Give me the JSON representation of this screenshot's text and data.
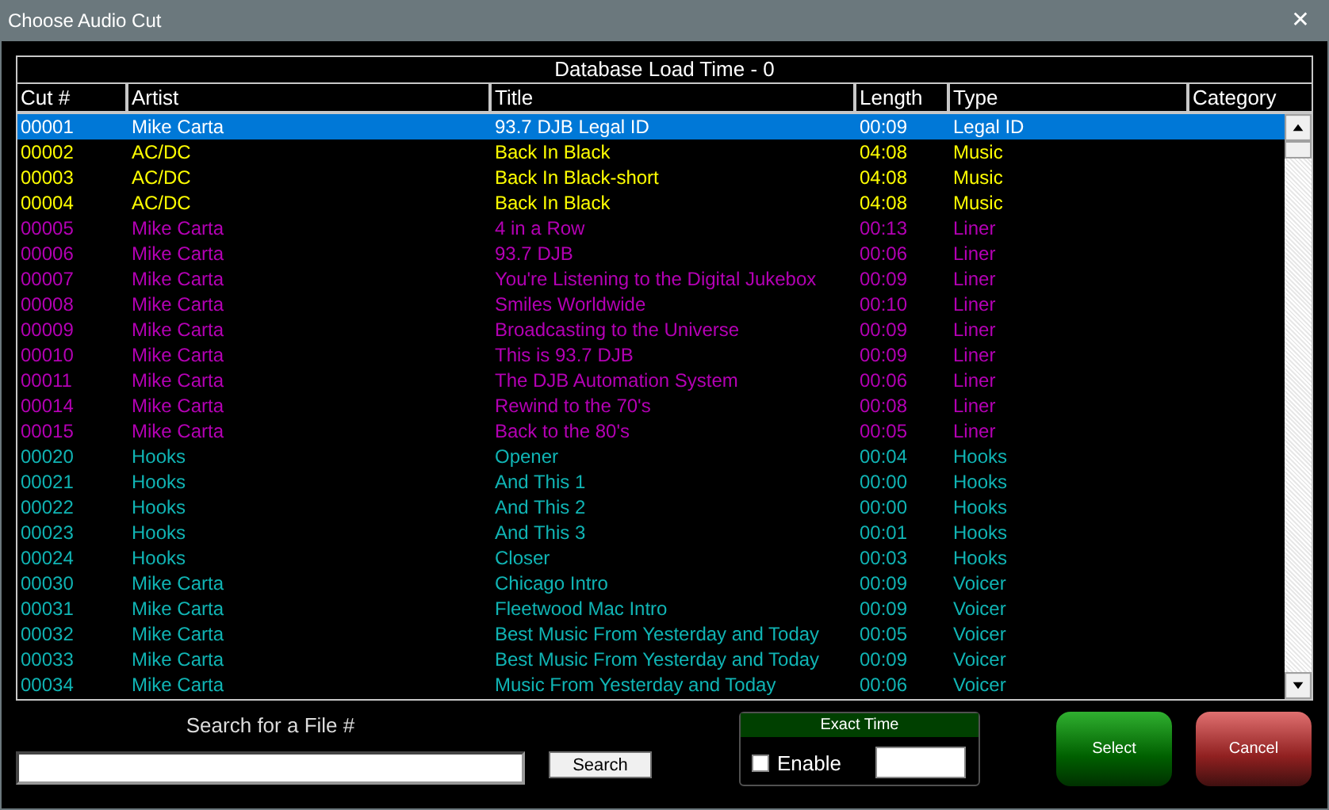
{
  "window": {
    "title": "Choose Audio Cut",
    "close": "✕"
  },
  "table": {
    "caption": "Database Load Time - 0",
    "columns": [
      "Cut #",
      "Artist",
      "Title",
      "Length",
      "Type",
      "Category"
    ],
    "rows": [
      {
        "cut": "00001",
        "artist": "Mike Carta",
        "title": "93.7 DJB Legal ID",
        "length": "00:09",
        "type": "Legal ID",
        "selected": true
      },
      {
        "cut": "00002",
        "artist": "AC/DC",
        "title": "Back In Black",
        "length": "04:08",
        "type": "Music",
        "color": "#ffff00",
        "selected": false
      },
      {
        "cut": "00003",
        "artist": "AC/DC",
        "title": "Back In Black-short",
        "length": "04:08",
        "type": "Music",
        "color": "#ffff00",
        "selected": false
      },
      {
        "cut": "00004",
        "artist": "AC/DC",
        "title": "Back In Black",
        "length": "04:08",
        "type": "Music",
        "color": "#ffff00",
        "selected": false
      },
      {
        "cut": "00005",
        "artist": "Mike Carta",
        "title": "4 in a Row",
        "length": "00:13",
        "type": "Liner",
        "color": "#b400b4",
        "selected": false
      },
      {
        "cut": "00006",
        "artist": "Mike Carta",
        "title": "93.7 DJB",
        "length": "00:06",
        "type": "Liner",
        "color": "#b400b4",
        "selected": false
      },
      {
        "cut": "00007",
        "artist": "Mike Carta",
        "title": "You're Listening to the Digital Jukebox",
        "length": "00:09",
        "type": "Liner",
        "color": "#b400b4",
        "selected": false
      },
      {
        "cut": "00008",
        "artist": "Mike Carta",
        "title": "Smiles Worldwide",
        "length": "00:10",
        "type": "Liner",
        "color": "#b400b4",
        "selected": false
      },
      {
        "cut": "00009",
        "artist": "Mike Carta",
        "title": "Broadcasting to the Universe",
        "length": "00:09",
        "type": "Liner",
        "color": "#b400b4",
        "selected": false
      },
      {
        "cut": "00010",
        "artist": "Mike Carta",
        "title": "This is 93.7 DJB",
        "length": "00:09",
        "type": "Liner",
        "color": "#b400b4",
        "selected": false
      },
      {
        "cut": "00011",
        "artist": "Mike Carta",
        "title": "The DJB Automation System",
        "length": "00:06",
        "type": "Liner",
        "color": "#b400b4",
        "selected": false
      },
      {
        "cut": "00014",
        "artist": "Mike Carta",
        "title": "Rewind to the 70's",
        "length": "00:08",
        "type": "Liner",
        "color": "#b400b4",
        "selected": false
      },
      {
        "cut": "00015",
        "artist": "Mike Carta",
        "title": "Back to the 80's",
        "length": "00:05",
        "type": "Liner",
        "color": "#b400b4",
        "selected": false
      },
      {
        "cut": "00020",
        "artist": "Hooks",
        "title": "Opener",
        "length": "00:04",
        "type": "Hooks",
        "color": "#10b4b4",
        "selected": false
      },
      {
        "cut": "00021",
        "artist": "Hooks",
        "title": "And This 1",
        "length": "00:00",
        "type": "Hooks",
        "color": "#10b4b4",
        "selected": false
      },
      {
        "cut": "00022",
        "artist": "Hooks",
        "title": "And This 2",
        "length": "00:00",
        "type": "Hooks",
        "color": "#10b4b4",
        "selected": false
      },
      {
        "cut": "00023",
        "artist": "Hooks",
        "title": "And This 3",
        "length": "00:01",
        "type": "Hooks",
        "color": "#10b4b4",
        "selected": false
      },
      {
        "cut": "00024",
        "artist": "Hooks",
        "title": "Closer",
        "length": "00:03",
        "type": "Hooks",
        "color": "#10b4b4",
        "selected": false
      },
      {
        "cut": "00030",
        "artist": "Mike Carta",
        "title": "Chicago Intro",
        "length": "00:09",
        "type": "Voicer",
        "color": "#10b4b4",
        "selected": false
      },
      {
        "cut": "00031",
        "artist": "Mike Carta",
        "title": "Fleetwood Mac Intro",
        "length": "00:09",
        "type": "Voicer",
        "color": "#10b4b4",
        "selected": false
      },
      {
        "cut": "00032",
        "artist": "Mike Carta",
        "title": "Best Music From Yesterday and Today",
        "length": "00:05",
        "type": "Voicer",
        "color": "#10b4b4",
        "selected": false
      },
      {
        "cut": "00033",
        "artist": "Mike Carta",
        "title": "Best Music From Yesterday and Today",
        "length": "00:09",
        "type": "Voicer",
        "color": "#10b4b4",
        "selected": false
      },
      {
        "cut": "00034",
        "artist": "Mike Carta",
        "title": "Music From Yesterday and Today",
        "length": "00:06",
        "type": "Voicer",
        "color": "#10b4b4",
        "selected": false
      }
    ]
  },
  "search": {
    "label": "Search for a File #",
    "button": "Search"
  },
  "exact_time": {
    "title": "Exact Time",
    "enable_label": "Enable",
    "checked": false
  },
  "buttons": [
    {
      "label": "Select",
      "kind": "select"
    },
    {
      "label": "Cancel",
      "kind": "cancel"
    }
  ]
}
